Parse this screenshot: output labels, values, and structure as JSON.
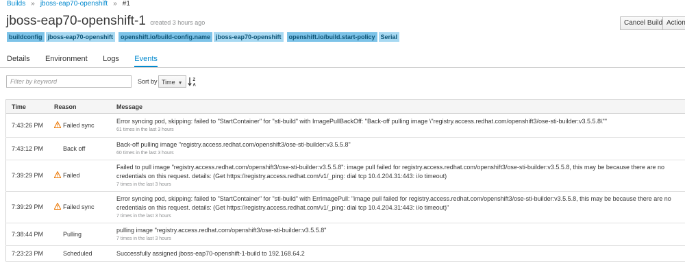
{
  "breadcrumb": {
    "items": [
      "Builds",
      "jboss-eap70-openshift",
      "#1"
    ],
    "separator": "»"
  },
  "header": {
    "title": "jboss-eap70-openshift-1",
    "created": "created 3 hours ago"
  },
  "actions": {
    "cancel_build": "Cancel Build",
    "actions": "Actions"
  },
  "labels": [
    {
      "key": "buildconfig",
      "value": "jboss-eap70-openshift"
    },
    {
      "key": "openshift.io/build-config.name",
      "value": "jboss-eap70-openshift"
    },
    {
      "key": "openshift.io/build.start-policy",
      "value": "Serial"
    }
  ],
  "tabs": {
    "details": "Details",
    "environment": "Environment",
    "logs": "Logs",
    "events": "Events",
    "active": "Events"
  },
  "filter": {
    "placeholder": "Filter by keyword",
    "value": ""
  },
  "sort": {
    "label": "Sort by",
    "selected": "Time",
    "direction_icon": "sort-alpha-desc-icon"
  },
  "table": {
    "headers": [
      "Time",
      "Reason",
      "Message"
    ],
    "rows": [
      {
        "time": "7:43:26 PM",
        "reason": "Failed sync",
        "warning": true,
        "message": "Error syncing pod, skipping: failed to \"StartContainer\" for \"sti-build\" with ImagePullBackOff: \"Back-off pulling image \\\"registry.access.redhat.com/openshift3/ose-sti-builder:v3.5.5.8\\\"\"",
        "count": "61 times in the last 3 hours"
      },
      {
        "time": "7:43:12 PM",
        "reason": "Back off",
        "warning": false,
        "message": "Back-off pulling image \"registry.access.redhat.com/openshift3/ose-sti-builder:v3.5.5.8\"",
        "count": "60 times in the last 3 hours"
      },
      {
        "time": "7:39:29 PM",
        "reason": "Failed",
        "warning": true,
        "message": "Failed to pull image \"registry.access.redhat.com/openshift3/ose-sti-builder:v3.5.5.8\": image pull failed for registry.access.redhat.com/openshift3/ose-sti-builder:v3.5.5.8, this may be because there are no credentials on this request. details: (Get https://registry.access.redhat.com/v1/_ping: dial tcp 10.4.204.31:443: i/o timeout)",
        "count": "7 times in the last 3 hours"
      },
      {
        "time": "7:39:29 PM",
        "reason": "Failed sync",
        "warning": true,
        "message": "Error syncing pod, skipping: failed to \"StartContainer\" for \"sti-build\" with ErrImagePull: \"image pull failed for registry.access.redhat.com/openshift3/ose-sti-builder:v3.5.5.8, this may be because there are no credentials on this request. details: (Get https://registry.access.redhat.com/v1/_ping: dial tcp 10.4.204.31:443: i/o timeout)\"",
        "count": "7 times in the last 3 hours"
      },
      {
        "time": "7:38:44 PM",
        "reason": "Pulling",
        "warning": false,
        "message": "pulling image \"registry.access.redhat.com/openshift3/ose-sti-builder:v3.5.5.8\"",
        "count": "7 times in the last 3 hours"
      },
      {
        "time": "7:23:23 PM",
        "reason": "Scheduled",
        "warning": false,
        "message": "Successfully assigned jboss-eap70-openshift-1-build to 192.168.64.2",
        "count": ""
      }
    ]
  },
  "colors": {
    "link": "#0088ce",
    "warning": "#ec7a08",
    "label_key": "#7dc3e8",
    "label_value": "#a8d9f2"
  }
}
